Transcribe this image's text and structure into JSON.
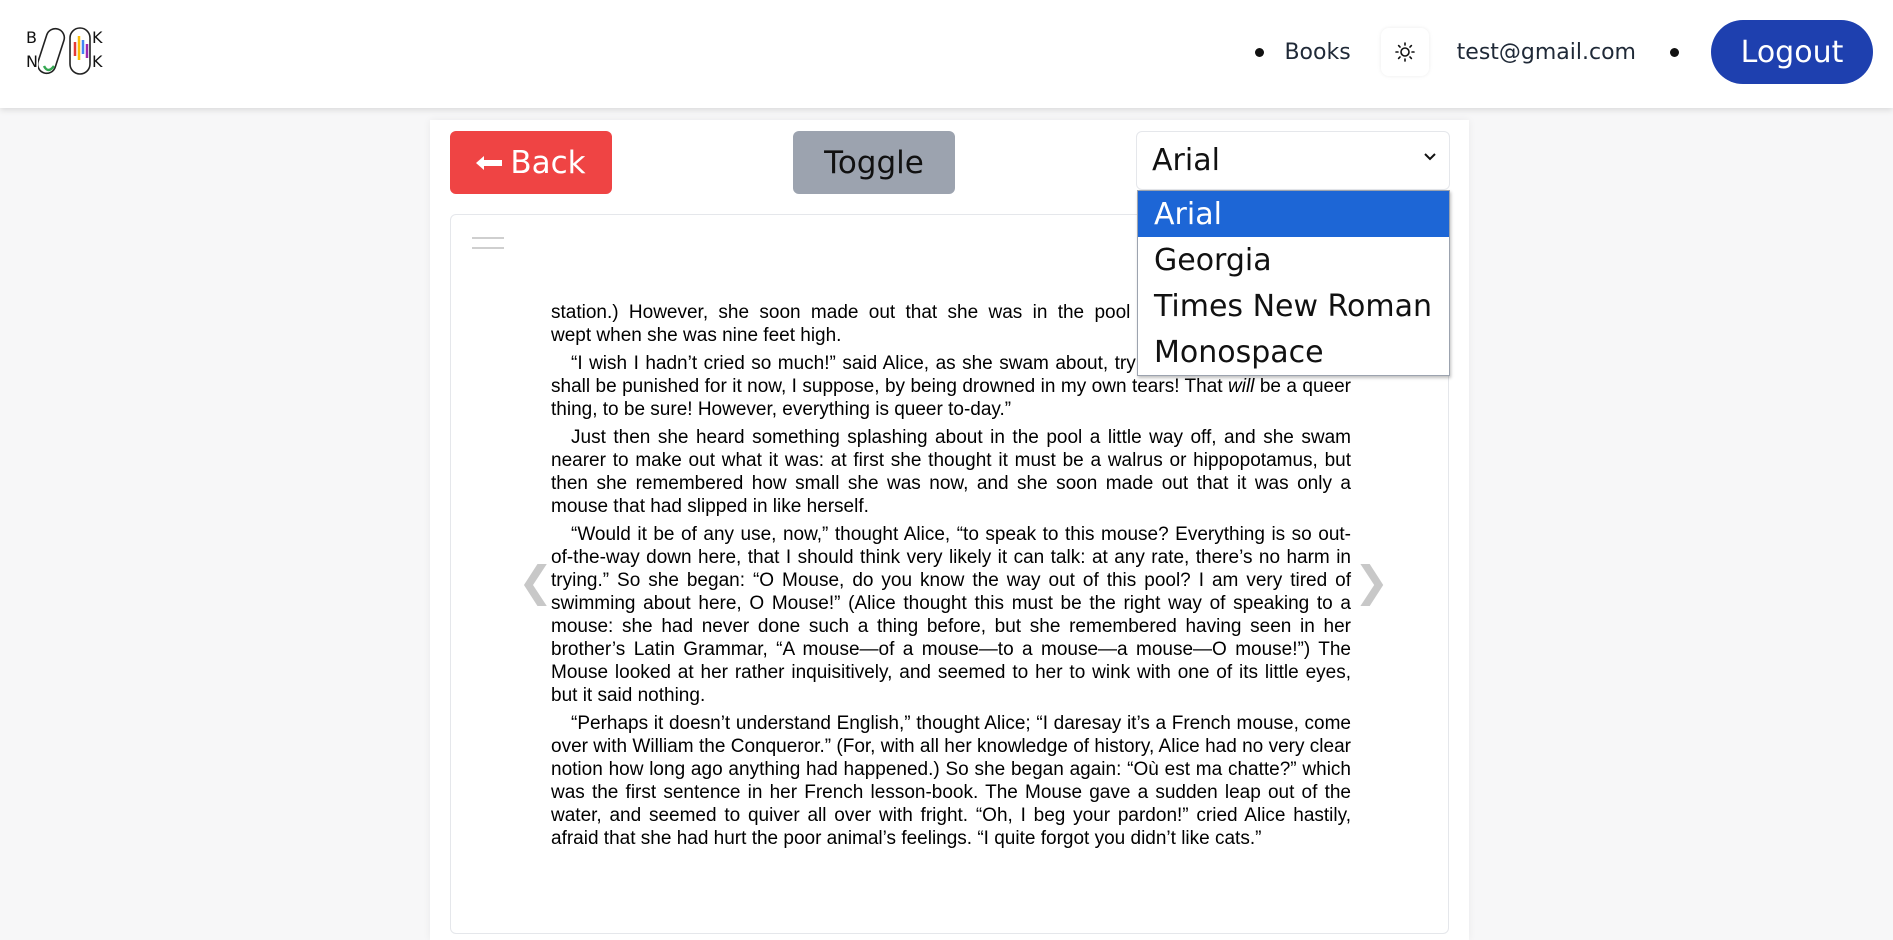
{
  "header": {
    "logo_letters": [
      "B",
      "N",
      "K",
      "K"
    ],
    "nav_books": "Books",
    "theme_icon": "sun-icon",
    "user_email": "test@gmail.com",
    "logout_label": "Logout",
    "logout_color": "#1e40af"
  },
  "toolbar": {
    "back_label": "Back",
    "back_icon": "arrow-left-icon",
    "back_color": "#ef4444",
    "toggle_label": "Toggle",
    "font_selected": "Arial",
    "font_options": [
      "Arial",
      "Georgia",
      "Times New Roman",
      "Monospace"
    ]
  },
  "reader": {
    "p1a": "station.) However, she soon made out that she was in the pool of tears which she had",
    "p1b": "wept when she was nine feet high.",
    "p2_before_will": "“I wish I hadn’t cried so much!” said Alice, as she swam about, trying to find her way out. “I shall be punished for it now, I suppose, by being drowned in my own tears! That ",
    "p2_will": "will",
    "p2_after_will": " be a queer thing, to be sure! However, everything is queer to-day.”",
    "p3": "Just then she heard something splashing about in the pool a little way off, and she swam nearer to make out what it was: at first she thought it must be a walrus or hippopotamus, but then she remembered how small she was now, and she soon made out that it was only a mouse that had slipped in like herself.",
    "p4": "“Would it be of any use, now,” thought Alice, “to speak to this mouse? Everything is so out-of-the-way down here, that I should think very likely it can talk: at any rate, there’s no harm in trying.” So she began: “O Mouse, do you know the way out of this pool? I am very tired of swimming about here, O Mouse!” (Alice thought this must be the right way of speaking to a mouse: she had never done such a thing before, but she remembered having seen in her brother’s Latin Grammar, “A mouse—of a mouse—to a mouse—a mouse—O mouse!”) The Mouse looked at her rather inquisitively, and seemed to her to wink with one of its little eyes, but it said nothing.",
    "p5": "“Perhaps it doesn’t understand English,” thought Alice; “I daresay it’s a French mouse, come over with William the Conqueror.” (For, with all her knowledge of history, Alice had no very clear notion how long ago anything had happened.) So she began again: “Où est ma chatte?” which was the first sentence in her French lesson-book. The Mouse gave a sudden leap out of the water, and seemed to quiver all over with fright. “Oh, I beg your pardon!” cried Alice hastily, afraid that she had hurt the poor animal’s feelings. “I quite forgot you didn’t like cats.”",
    "prev_arrow": "❮",
    "next_arrow": "❯"
  }
}
